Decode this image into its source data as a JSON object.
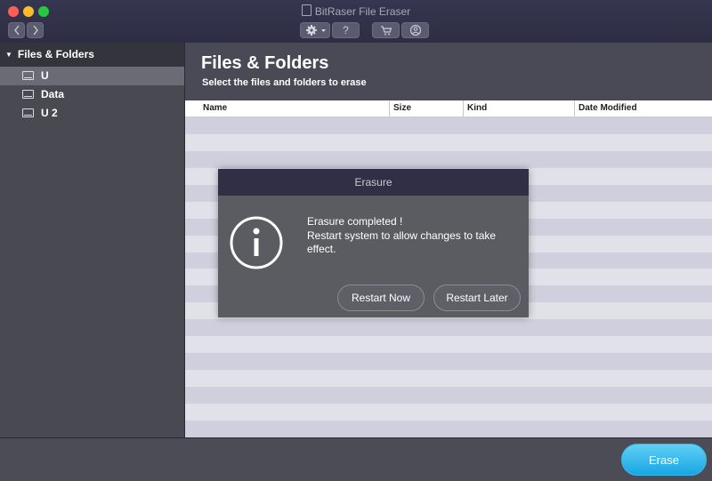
{
  "window": {
    "title": "BitRaser File Eraser"
  },
  "toolbar": {
    "help_label": "?",
    "icons": [
      "chevron-left-icon",
      "chevron-right-icon",
      "gear-icon",
      "chevron-down-icon",
      "cart-icon",
      "user-icon"
    ]
  },
  "sidebar": {
    "header": "Files & Folders",
    "items": [
      {
        "label": "U",
        "selected": true
      },
      {
        "label": "Data",
        "selected": false
      },
      {
        "label": "U 2",
        "selected": false
      }
    ]
  },
  "main": {
    "title": "Files & Folders",
    "subtitle": "Select the files and folders to erase",
    "columns": [
      "Name",
      "Size",
      "Kind",
      "Date Modified"
    ]
  },
  "dialog": {
    "title": "Erasure",
    "message_line1": "Erasure completed !",
    "message_line2": "Restart system to allow changes to take effect.",
    "restart_now": "Restart Now",
    "restart_later": "Restart Later"
  },
  "footer": {
    "erase_label": "Erase"
  },
  "colors": {
    "accent": "#18a6e3",
    "titlebar": "#2d2d44",
    "dialog_bg": "#5b5b62"
  }
}
